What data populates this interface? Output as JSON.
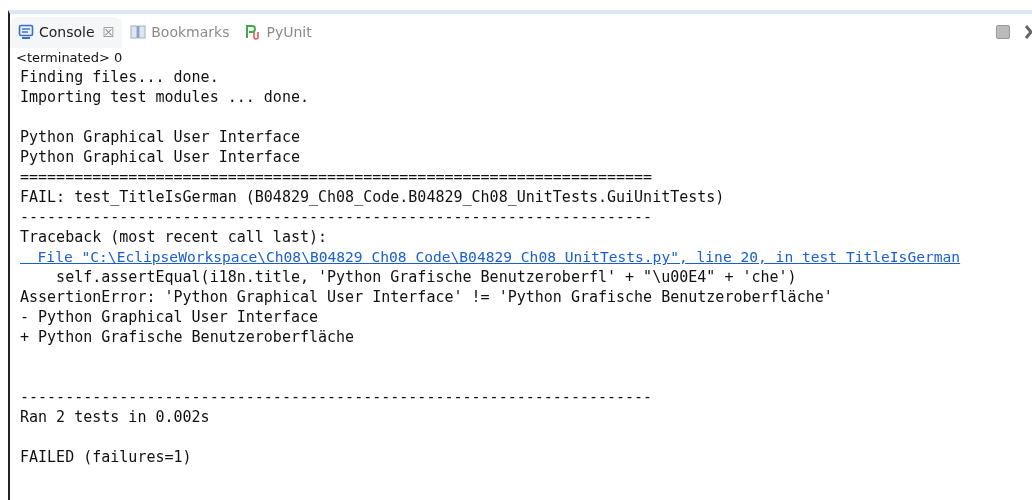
{
  "tabs": [
    {
      "label": "Console",
      "kind": "console",
      "selected": true,
      "closable": true
    },
    {
      "label": "Bookmarks",
      "kind": "bookmarks",
      "selected": false,
      "closable": false
    },
    {
      "label": "PyUnit",
      "kind": "pyunit",
      "selected": false,
      "closable": false
    }
  ],
  "close_tab_glyph": "☒",
  "status": "<terminated> 0",
  "lines": [
    {
      "kind": "text",
      "text": "Finding files... done."
    },
    {
      "kind": "text",
      "text": "Importing test modules ... done."
    },
    {
      "kind": "blank"
    },
    {
      "kind": "text",
      "text": "Python Graphical User Interface"
    },
    {
      "kind": "text",
      "text": "Python Graphical User Interface"
    },
    {
      "kind": "text",
      "text": "======================================================================"
    },
    {
      "kind": "text",
      "text": "FAIL: test_TitleIsGerman (B04829_Ch08_Code.B04829_Ch08_UnitTests.GuiUnitTests)"
    },
    {
      "kind": "text",
      "text": "----------------------------------------------------------------------"
    },
    {
      "kind": "text",
      "text": "Traceback (most recent call last):"
    },
    {
      "kind": "link",
      "text": "  File \"C:\\EclipseWorkspace\\Ch08\\B04829 Ch08 Code\\B04829 Ch08 UnitTests.py\", line 20, in test TitleIsGerman"
    },
    {
      "kind": "text",
      "text": "    self.assertEqual(i18n.title, 'Python Grafische Benutzeroberfl' + \"\\u00E4\" + 'che')"
    },
    {
      "kind": "text",
      "text": "AssertionError: 'Python Graphical User Interface' != 'Python Grafische Benutzeroberfläche'"
    },
    {
      "kind": "text",
      "text": "- Python Graphical User Interface"
    },
    {
      "kind": "text",
      "text": "+ Python Grafische Benutzeroberfläche"
    },
    {
      "kind": "blank"
    },
    {
      "kind": "blank"
    },
    {
      "kind": "text",
      "text": "----------------------------------------------------------------------"
    },
    {
      "kind": "text",
      "text": "Ran 2 tests in 0.002s"
    },
    {
      "kind": "blank"
    },
    {
      "kind": "text",
      "text": "FAILED (failures=1)"
    }
  ]
}
